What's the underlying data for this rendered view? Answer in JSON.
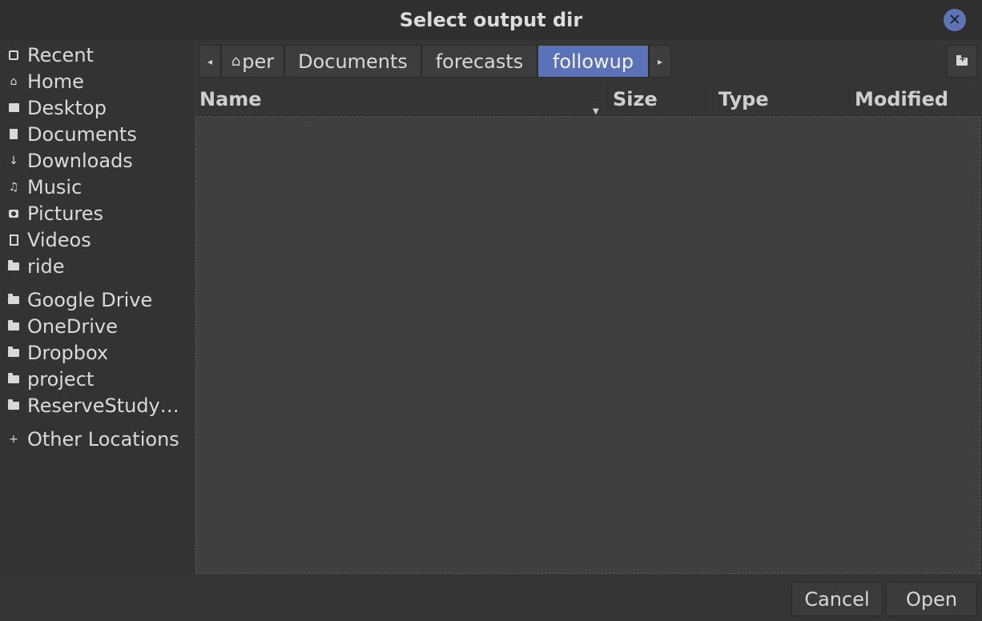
{
  "window": {
    "title": "Select output dir"
  },
  "sidebar": {
    "items": [
      {
        "label": "Recent",
        "icon": "recent-icon"
      },
      {
        "label": "Home",
        "icon": "home-icon"
      },
      {
        "label": "Desktop",
        "icon": "desktop-icon"
      },
      {
        "label": "Documents",
        "icon": "document-icon"
      },
      {
        "label": "Downloads",
        "icon": "download-icon"
      },
      {
        "label": "Music",
        "icon": "music-icon"
      },
      {
        "label": "Pictures",
        "icon": "camera-icon"
      },
      {
        "label": "Videos",
        "icon": "film-icon"
      },
      {
        "label": "ride",
        "icon": "folder-icon"
      },
      {
        "label": "Google Drive",
        "icon": "folder-icon"
      },
      {
        "label": "OneDrive",
        "icon": "folder-icon"
      },
      {
        "label": "Dropbox",
        "icon": "folder-icon"
      },
      {
        "label": "project",
        "icon": "folder-icon"
      },
      {
        "label": "ReserveStudy…",
        "icon": "folder-icon"
      },
      {
        "label": "Other Locations",
        "icon": "plus-icon"
      }
    ]
  },
  "pathbar": {
    "crumbs": [
      {
        "label": "per"
      },
      {
        "label": "Documents"
      },
      {
        "label": "forecasts"
      },
      {
        "label": "followup"
      }
    ]
  },
  "columns": {
    "name": "Name",
    "size": "Size",
    "type": "Type",
    "modified": "Modified"
  },
  "buttons": {
    "cancel": "Cancel",
    "open": "Open"
  },
  "colors": {
    "accent": "#5b71b8",
    "background": "#353535",
    "list_background": "#3f3f3f"
  }
}
